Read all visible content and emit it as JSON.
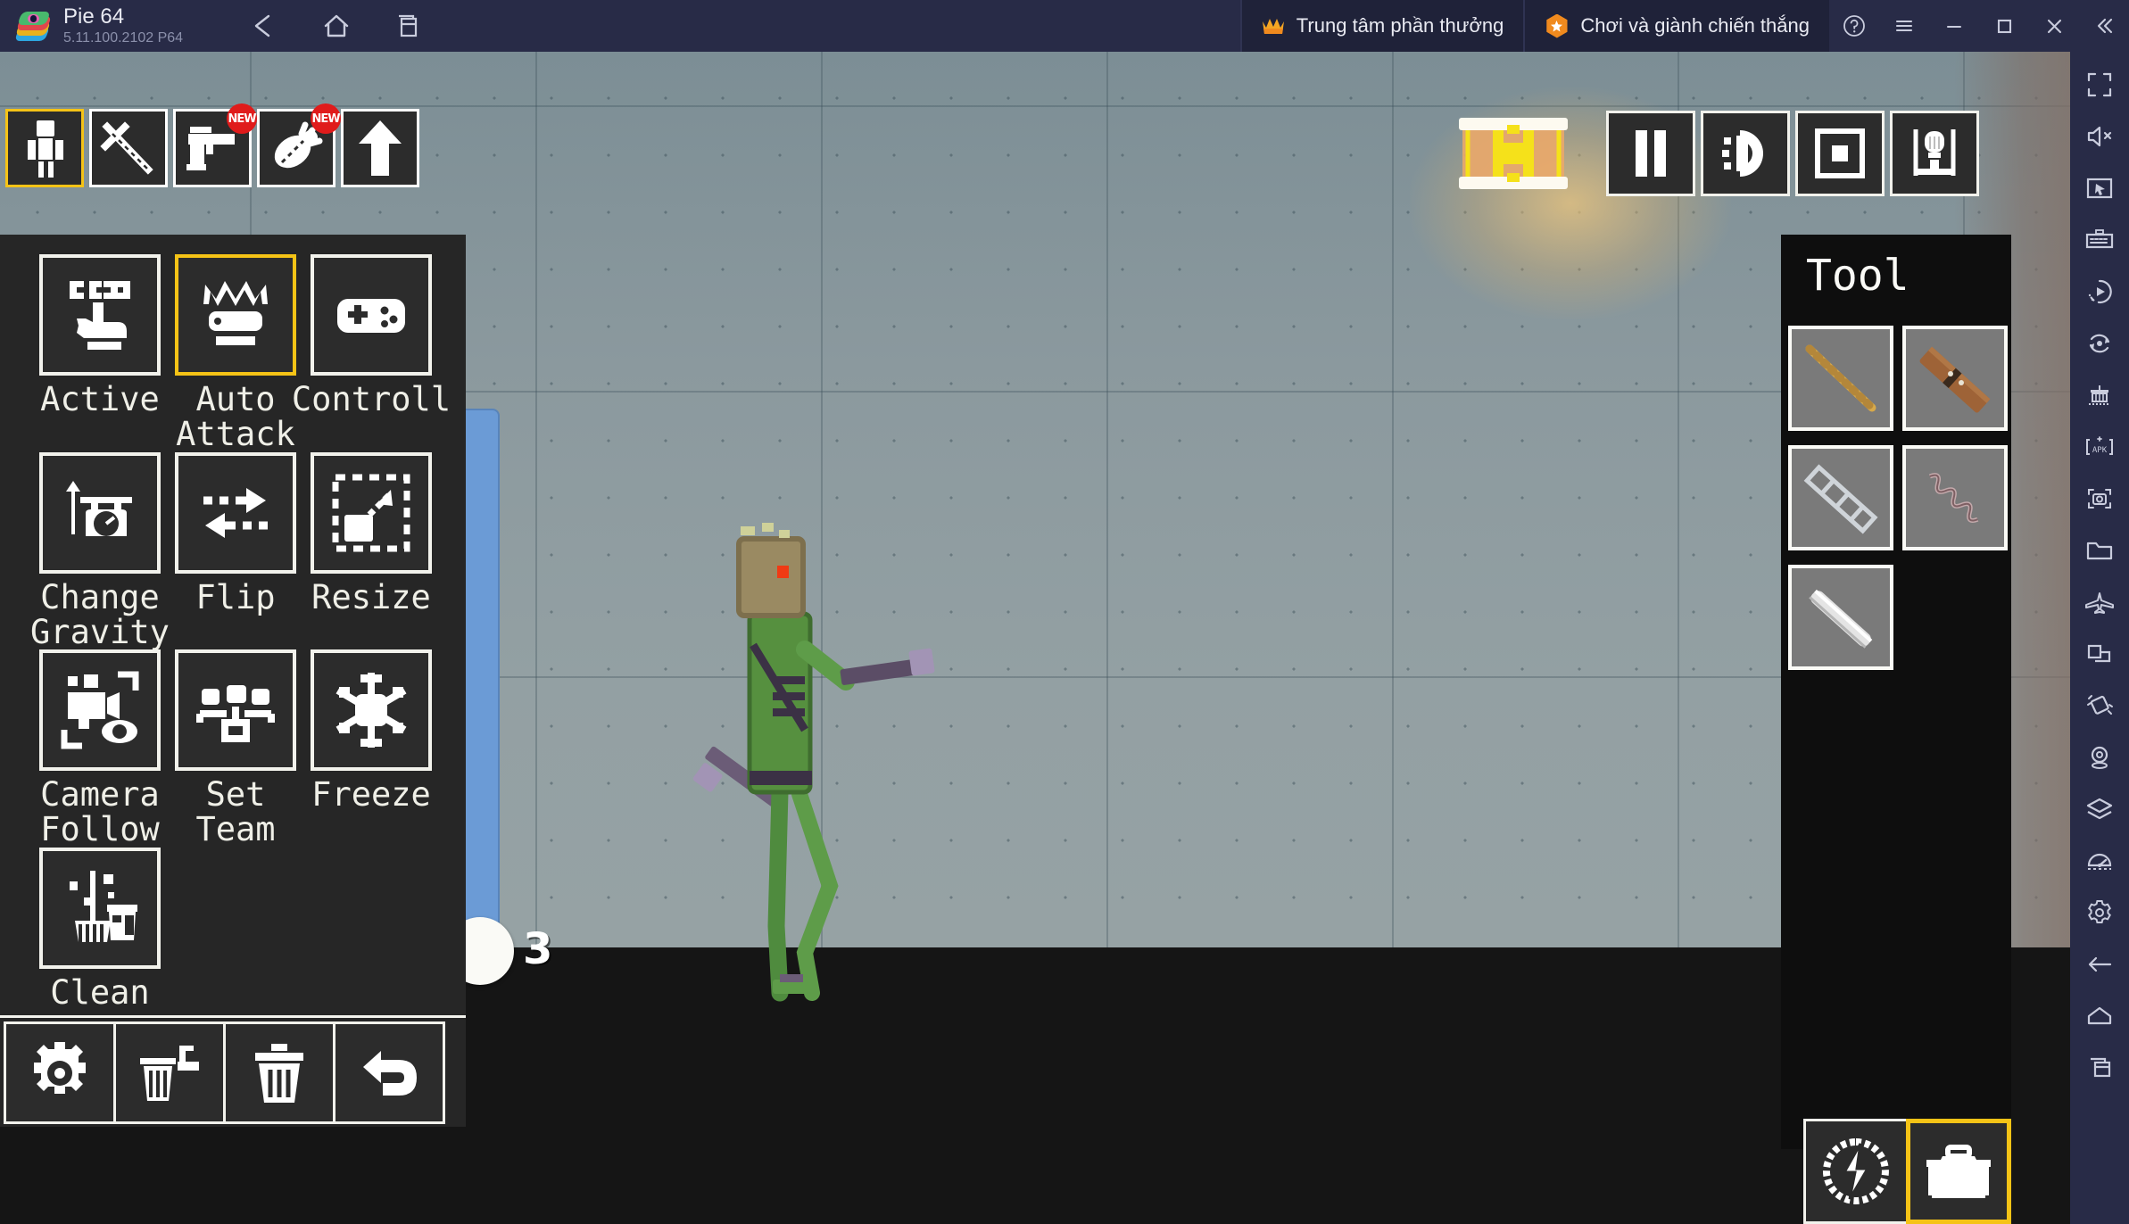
{
  "titlebar": {
    "app_title": "Pie 64",
    "app_version": "5.11.100.2102  P64",
    "nav": [
      {
        "name": "back-icon",
        "label": "Back"
      },
      {
        "name": "home-icon",
        "label": "Home"
      },
      {
        "name": "multi-instance-icon",
        "label": "Instances"
      }
    ],
    "promos": [
      {
        "icon": "crown-icon",
        "label": "Trung tâm phần thưởng"
      },
      {
        "icon": "star-icon",
        "label": "Chơi và giành chiến thắng"
      }
    ],
    "window_controls": [
      {
        "name": "help-icon",
        "label": "Help"
      },
      {
        "name": "menu-icon",
        "label": "Menu"
      },
      {
        "name": "minimize-icon",
        "label": "Minimize"
      },
      {
        "name": "maximize-icon",
        "label": "Maximize"
      },
      {
        "name": "close-icon",
        "label": "Close"
      },
      {
        "name": "collapse-sidebar-icon",
        "label": "Collapse"
      }
    ]
  },
  "sidebar": {
    "items": [
      {
        "name": "fullscreen-icon",
        "label": "Fullscreen"
      },
      {
        "name": "mute-icon",
        "label": "Mute"
      },
      {
        "name": "cursor-icon",
        "label": "Pointer"
      },
      {
        "name": "keyboard-icon",
        "label": "Keyboard controls"
      },
      {
        "name": "macro-record-icon",
        "label": "Macro"
      },
      {
        "name": "rotate-icon",
        "label": "Rotate"
      },
      {
        "name": "multi-instance-sync-icon",
        "label": "Sync"
      },
      {
        "name": "install-apk-icon",
        "label": "Install APK"
      },
      {
        "name": "screenshot-icon",
        "label": "Screenshot"
      },
      {
        "name": "folder-icon",
        "label": "Media folder"
      },
      {
        "name": "airplane-icon",
        "label": "Airplane"
      },
      {
        "name": "resize-window-icon",
        "label": "Resize"
      },
      {
        "name": "shake-icon",
        "label": "Shake"
      },
      {
        "name": "location-icon",
        "label": "Location"
      },
      {
        "name": "layers-icon",
        "label": "Layers"
      },
      {
        "name": "performance-icon",
        "label": "Performance"
      },
      {
        "name": "settings-gear-icon",
        "label": "Settings"
      },
      {
        "name": "back-arrow-icon",
        "label": "Back"
      },
      {
        "name": "home-nav-icon",
        "label": "Home"
      },
      {
        "name": "recents-icon",
        "label": "Recents"
      }
    ]
  },
  "game": {
    "top_categories": [
      {
        "name": "human-category-icon",
        "label": "Human",
        "selected": true,
        "badge": null
      },
      {
        "name": "melee-category-icon",
        "label": "Melee",
        "selected": false,
        "badge": null
      },
      {
        "name": "gun-category-icon",
        "label": "Guns",
        "selected": false,
        "badge": "NEW"
      },
      {
        "name": "explosive-category-icon",
        "label": "Explosives",
        "selected": false,
        "badge": "NEW"
      },
      {
        "name": "arrow-category-icon",
        "label": "Arrow",
        "selected": false,
        "badge": null
      }
    ],
    "menu_items": [
      {
        "name": "active-button",
        "label": "Active",
        "icon": "pointing-hand-icon",
        "selected": false
      },
      {
        "name": "auto-attack-button",
        "label": "Auto\nAttack",
        "icon": "saw-crown-icon",
        "selected": true
      },
      {
        "name": "controll-button",
        "label": "Controll",
        "icon": "gamepad-icon",
        "selected": false
      },
      {
        "name": "change-gravity-button",
        "label": "Change\nGravity",
        "icon": "gravity-icon",
        "selected": false
      },
      {
        "name": "flip-button",
        "label": "Flip",
        "icon": "flip-arrows-icon",
        "selected": false
      },
      {
        "name": "resize-button",
        "label": "Resize",
        "icon": "resize-box-icon",
        "selected": false
      },
      {
        "name": "camera-follow-button",
        "label": "Camera\nFollow",
        "icon": "camera-eye-icon",
        "selected": false
      },
      {
        "name": "set-team-button",
        "label": "Set\nTeam",
        "icon": "team-icon",
        "selected": false
      },
      {
        "name": "freeze-button",
        "label": "Freeze",
        "icon": "snowflake-icon",
        "selected": false
      },
      {
        "name": "clean-button",
        "label": "Clean",
        "icon": "broom-icon",
        "selected": false
      }
    ],
    "bottom_actions": [
      {
        "name": "settings-button",
        "icon": "gear-icon",
        "label": "Settings"
      },
      {
        "name": "delete-selected-button",
        "icon": "trash-add-icon",
        "label": "Delete selected"
      },
      {
        "name": "delete-all-button",
        "icon": "trash-icon",
        "label": "Delete all"
      },
      {
        "name": "undo-button",
        "icon": "undo-icon",
        "label": "Undo"
      }
    ],
    "slider": {
      "name": "spawn-count-slider",
      "value": "3"
    },
    "treasure": {
      "name": "treasure-chest-button",
      "label": "Treasure chest"
    },
    "playback_controls": [
      {
        "name": "pause-button",
        "icon": "pause-icon",
        "label": "Pause"
      },
      {
        "name": "slowmo-button",
        "icon": "slowmo-icon",
        "label": "Slow motion"
      },
      {
        "name": "fullscreen-toggle-button",
        "icon": "frame-icon",
        "label": "Frame"
      },
      {
        "name": "lightbulb-button",
        "icon": "lightbulb-icon",
        "label": "Light"
      }
    ]
  },
  "tool_panel": {
    "title": "Tool",
    "items": [
      {
        "name": "tool-rope",
        "label": "Rope",
        "color": "#d7a94a"
      },
      {
        "name": "tool-wood-plank",
        "label": "Wooden plank",
        "color": "#9e6337"
      },
      {
        "name": "tool-chain",
        "label": "Chain",
        "color": "#cfd4d9"
      },
      {
        "name": "tool-spring",
        "label": "Spring",
        "color": "#b9a0a2"
      },
      {
        "name": "tool-metal-rod",
        "label": "Metal rod",
        "color": "#e4e4e4"
      }
    ]
  },
  "bottom_right": [
    {
      "name": "power-button",
      "icon": "lightning-circle-icon",
      "label": "Power",
      "selected": false
    },
    {
      "name": "toolbox-button",
      "icon": "toolbox-icon",
      "label": "Toolbox",
      "selected": true
    }
  ],
  "colors": {
    "chrome": "#282b47",
    "accent_yellow": "#f5c316",
    "panel_dark": "#262626",
    "slider_blue": "#6b9bd6",
    "badge_red": "#e01b1b"
  }
}
